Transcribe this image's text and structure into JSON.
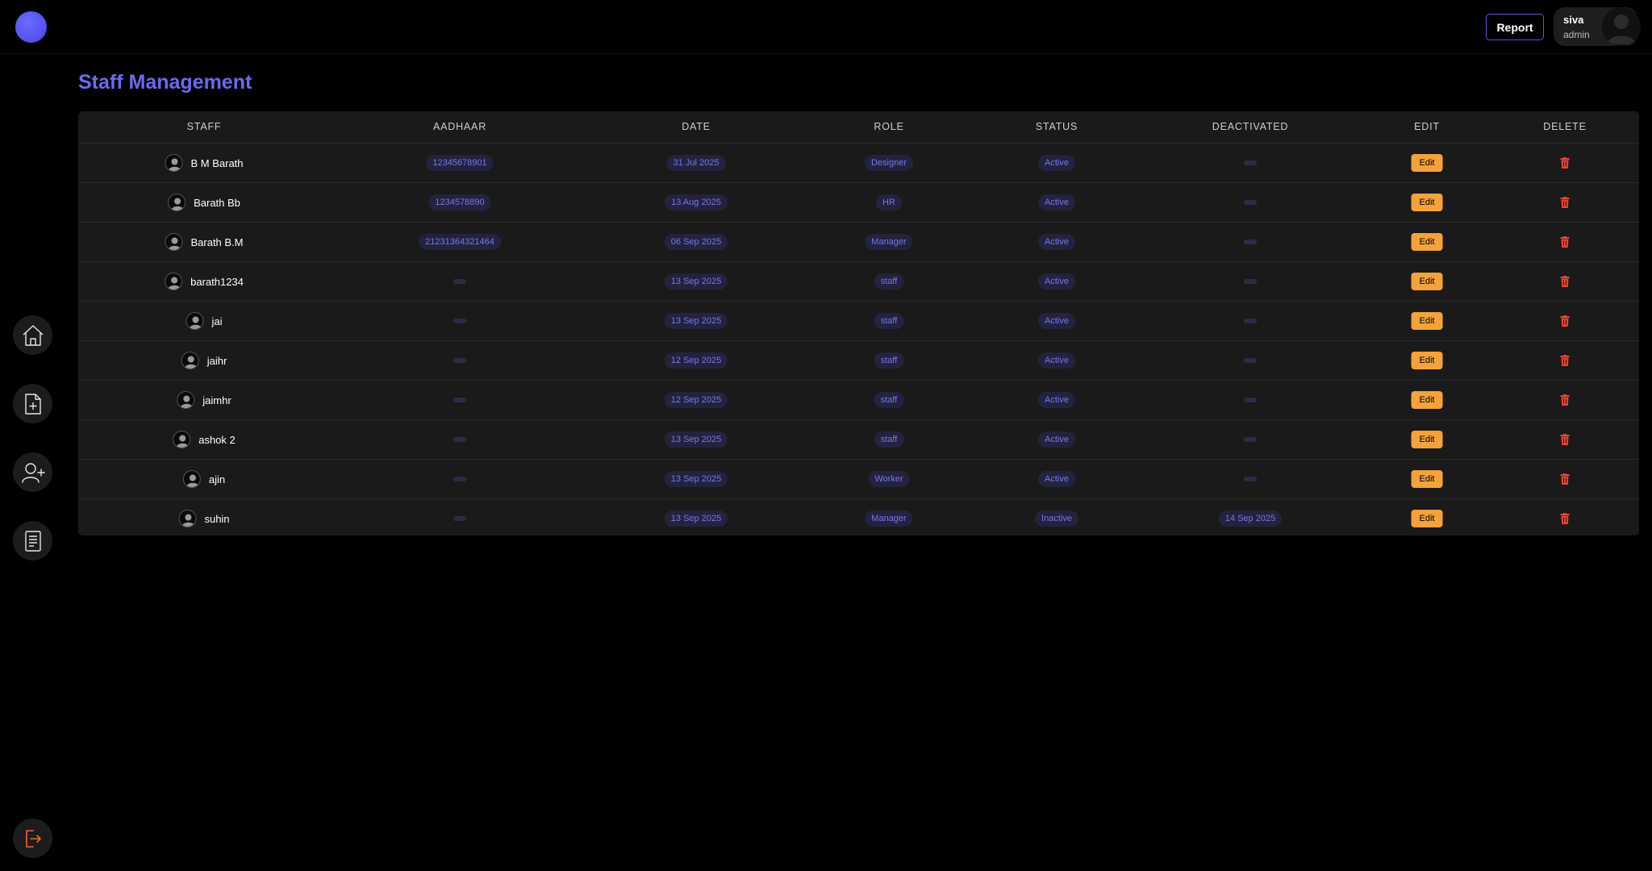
{
  "header": {
    "report_label": "Report",
    "user": {
      "name": "siva",
      "role": "admin"
    }
  },
  "sidebar": {
    "items": [
      {
        "icon": "home-icon"
      },
      {
        "icon": "add-document-icon"
      },
      {
        "icon": "add-user-icon"
      },
      {
        "icon": "report-list-icon"
      }
    ],
    "logout_icon": "logout-icon"
  },
  "page": {
    "title": "Staff Management"
  },
  "table": {
    "columns": [
      "STAFF",
      "AADHAAR",
      "DATE",
      "ROLE",
      "STATUS",
      "DEACTIVATED",
      "EDIT",
      "DELETE"
    ],
    "edit_label": "Edit",
    "rows": [
      {
        "name": "B M Barath",
        "aadhaar": "12345678901",
        "date": "31 Jul 2025",
        "role": "Designer",
        "status": "Active",
        "deactivated": ""
      },
      {
        "name": "Barath Bb",
        "aadhaar": "1234578890",
        "date": "13 Aug 2025",
        "role": "HR",
        "status": "Active",
        "deactivated": ""
      },
      {
        "name": "Barath B.M",
        "aadhaar": "21231364321464",
        "date": "06 Sep 2025",
        "role": "Manager",
        "status": "Active",
        "deactivated": ""
      },
      {
        "name": "barath1234",
        "aadhaar": "",
        "date": "13 Sep 2025",
        "role": "staff",
        "status": "Active",
        "deactivated": ""
      },
      {
        "name": "jai",
        "aadhaar": "",
        "date": "13 Sep 2025",
        "role": "staff",
        "status": "Active",
        "deactivated": ""
      },
      {
        "name": "jaihr",
        "aadhaar": "",
        "date": "12 Sep 2025",
        "role": "staff",
        "status": "Active",
        "deactivated": ""
      },
      {
        "name": "jaimhr",
        "aadhaar": "",
        "date": "12 Sep 2025",
        "role": "staff",
        "status": "Active",
        "deactivated": ""
      },
      {
        "name": "ashok 2",
        "aadhaar": "",
        "date": "13 Sep 2025",
        "role": "staff",
        "status": "Active",
        "deactivated": ""
      },
      {
        "name": "ajin",
        "aadhaar": "",
        "date": "13 Sep 2025",
        "role": "Worker",
        "status": "Active",
        "deactivated": ""
      },
      {
        "name": "suhin",
        "aadhaar": "",
        "date": "13 Sep 2025",
        "role": "Manager",
        "status": "Inactive",
        "deactivated": "14 Sep 2025"
      }
    ]
  },
  "colors": {
    "accent": "#6c69f0",
    "pill_bg": "#23233f",
    "pill_text": "#7a77e6",
    "edit_button": "#f5a23b",
    "delete_icon": "#e8452c",
    "logout_icon": "#f26a2e"
  }
}
